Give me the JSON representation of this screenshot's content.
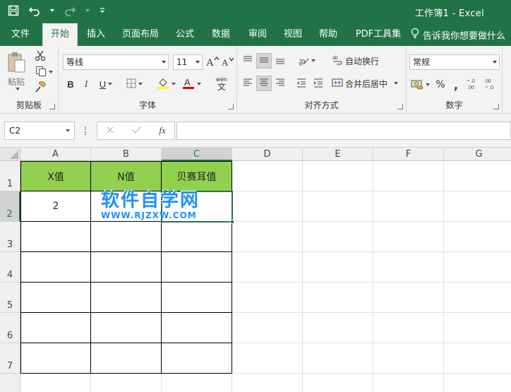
{
  "window": {
    "title": "工作簿1  -  Excel"
  },
  "tabs": [
    {
      "label": "文件",
      "active": false
    },
    {
      "label": "开始",
      "active": true
    },
    {
      "label": "插入",
      "active": false
    },
    {
      "label": "页面布局",
      "active": false
    },
    {
      "label": "公式",
      "active": false
    },
    {
      "label": "数据",
      "active": false
    },
    {
      "label": "审阅",
      "active": false
    },
    {
      "label": "视图",
      "active": false
    },
    {
      "label": "帮助",
      "active": false
    },
    {
      "label": "PDF工具集",
      "active": false
    }
  ],
  "tell_me": "告诉我你想要做什么",
  "ribbon": {
    "clipboard": {
      "label": "剪贴板",
      "paste": "粘贴"
    },
    "font": {
      "label": "字体",
      "name": "等线",
      "size": "11",
      "wen": "wén",
      "wen_char": "文"
    },
    "align": {
      "label": "对齐方式",
      "wrap": "自动换行",
      "merge": "合并后居中"
    },
    "number": {
      "label": "数字",
      "format": "常规",
      "percent": "%",
      "comma": ","
    }
  },
  "formula_bar": {
    "name_box": "C2",
    "fx": "fx",
    "value": ""
  },
  "columns": [
    "A",
    "B",
    "C",
    "D",
    "E",
    "F",
    "G"
  ],
  "rows": [
    "1",
    "2",
    "3",
    "4",
    "5",
    "6",
    "7"
  ],
  "cells": {
    "A1": "X值",
    "B1": "N值",
    "C1": "贝赛耳值",
    "A2": "2"
  },
  "watermark": {
    "cn": "软件自学网",
    "en": "WWW.RJZXW.COM"
  },
  "colors": {
    "excel_green": "#217346",
    "header_fill": "#92d050",
    "watermark": "#1e90ff"
  }
}
